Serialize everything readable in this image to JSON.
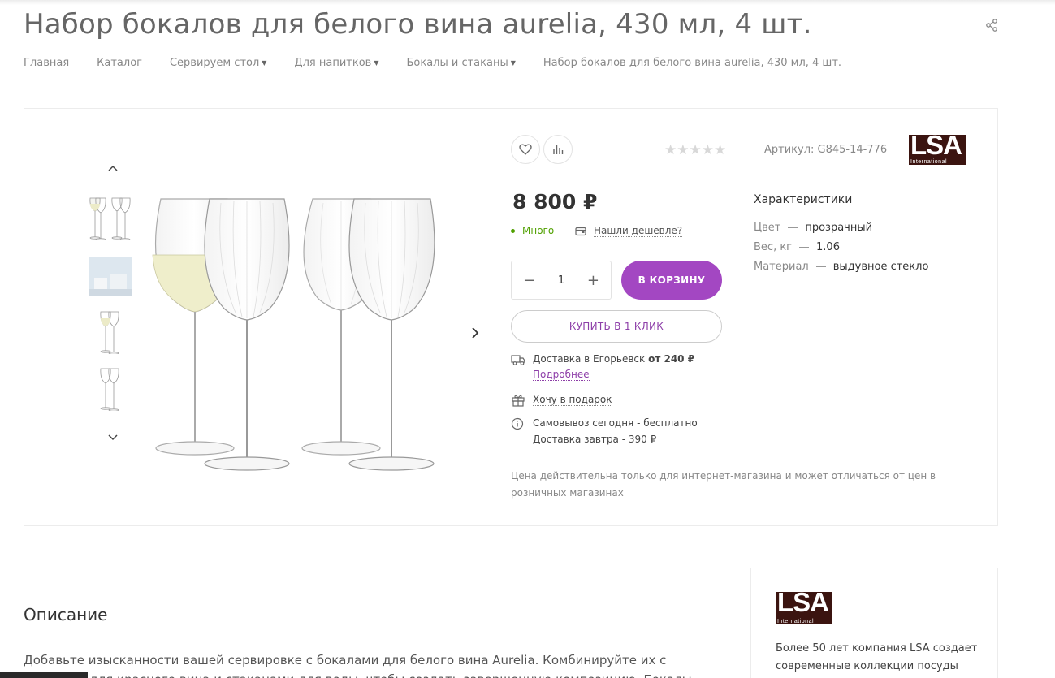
{
  "page": {
    "title": "Набор бокалов для белого вина aurelia, 430 мл, 4 шт."
  },
  "breadcrumbs": [
    {
      "label": "Главная",
      "dropdown": false
    },
    {
      "label": "Каталог",
      "dropdown": false
    },
    {
      "label": "Сервируем стол",
      "dropdown": true
    },
    {
      "label": "Для напитков",
      "dropdown": true
    },
    {
      "label": "Бокалы и стаканы",
      "dropdown": true
    },
    {
      "label": "Набор бокалов для белого вина aurelia, 430 мл, 4 шт.",
      "dropdown": false
    }
  ],
  "product": {
    "rating_stars": "★★★★★",
    "rating_value": 0,
    "sku": "Артикул: G845-14-776",
    "brand_logo_text": "LSA",
    "brand_logo_sub": "International",
    "price": "8 800 ₽",
    "stock": "Много",
    "cheaper_link": "Нашли дешевле?",
    "quantity": "1",
    "qty_minus": "−",
    "qty_plus": "+",
    "add_to_cart": "В КОРЗИНУ",
    "buy_one_click": "КУПИТЬ В 1 КЛИК",
    "delivery_text": "Доставка в Егорьевск",
    "delivery_price": "от 240 ₽",
    "delivery_more": "Подробнее",
    "gift": "Хочу в подарок",
    "pickup": "Самовывоз сегодня - бесплатно",
    "delivery_tomorrow": "Доставка завтра - 390 ₽",
    "price_note": "Цена действительна только для интернет-магазина и может отличаться от цен в розничных магазинах"
  },
  "characteristics": {
    "title": "Характеристики",
    "items": [
      {
        "key": "Цвет",
        "value": "прозрачный"
      },
      {
        "key": "Вес, кг",
        "value": "1.06"
      },
      {
        "key": "Материал",
        "value": "выдувное стекло"
      }
    ]
  },
  "description": {
    "title": "Описание",
    "text": "Добавьте изысканности вашей сервировке с бокалами для белого вина Aurelia. Комбинируйте их с бокалами для красного вина и стаканами для воды, чтобы создать завершенную композицию. Бокалы упакованы в стильную"
  },
  "brand_card": {
    "text": "Более 50 лет компания LSA создает современные коллекции посуды для"
  },
  "colors": {
    "accent": "#a347c2",
    "in_stock": "#50a000",
    "brand_bg": "#3b1410"
  }
}
